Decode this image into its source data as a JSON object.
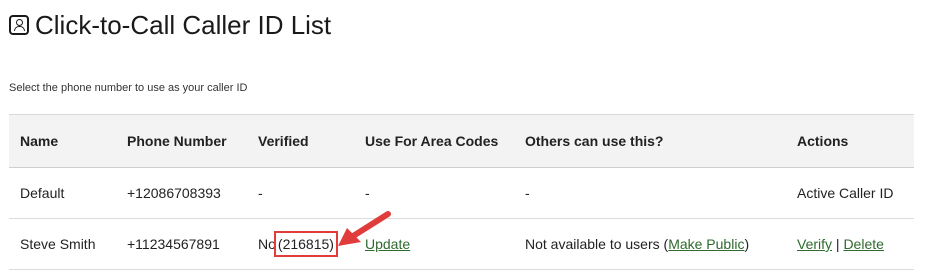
{
  "page": {
    "title": "Click-to-Call Caller ID List",
    "subtitle": "Select the phone number to use as your caller ID"
  },
  "table": {
    "headers": {
      "name": "Name",
      "phone": "Phone Number",
      "verified": "Verified",
      "area_codes": "Use For Area Codes",
      "others": "Others can use this?",
      "actions": "Actions"
    },
    "rows": [
      {
        "name": "Default",
        "phone": "+12086708393",
        "verified": "-",
        "area_codes": "-",
        "others": "-",
        "actions_text": "Active Caller ID"
      },
      {
        "name": "Steve Smith",
        "phone": "+11234567891",
        "verified_prefix": "No",
        "verified_code": "(216815)",
        "area_codes_link": "Update",
        "others_text": "Not available to users (",
        "others_link": "Make Public",
        "others_suffix": ")",
        "action_verify": "Verify",
        "action_separator": "|",
        "action_delete": "Delete"
      }
    ]
  },
  "colors": {
    "link": "#2f6a2f",
    "highlight": "#e03c3c",
    "header_bg": "#f3f3f3"
  }
}
